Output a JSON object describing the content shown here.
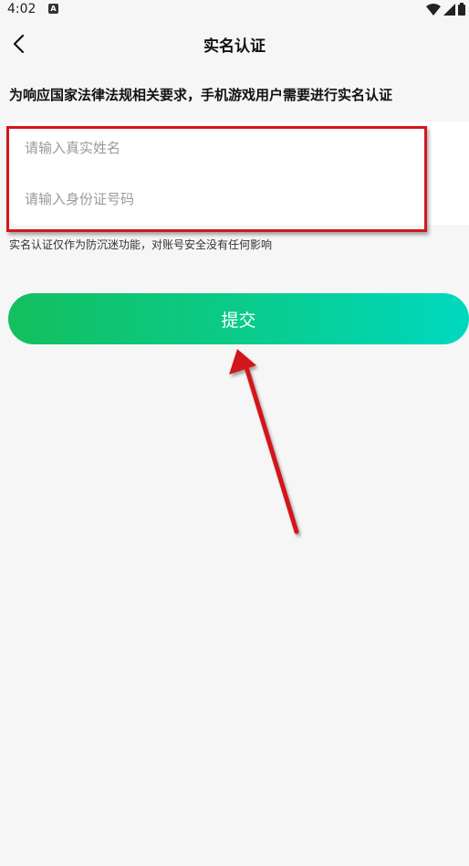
{
  "status_bar": {
    "time": "4:02",
    "notification_icon": "a-icon",
    "icons": [
      "wifi-icon",
      "signal-icon",
      "battery-icon"
    ]
  },
  "header": {
    "back_icon": "chevron-left-icon",
    "title": "实名认证"
  },
  "notice": "为响应国家法律法规相关要求，手机游戏用户需要进行实名认证",
  "form": {
    "name_placeholder": "请输入真实姓名",
    "name_value": "",
    "id_placeholder": "请输入身份证号码",
    "id_value": ""
  },
  "hint": "实名认证仅作为防沉迷功能，对账号安全没有任何影响",
  "submit_label": "提交",
  "colors": {
    "accent_start": "#13bf5e",
    "accent_end": "#00d8bf",
    "annotation_red": "#d3171d",
    "background": "#f6f6f6"
  }
}
